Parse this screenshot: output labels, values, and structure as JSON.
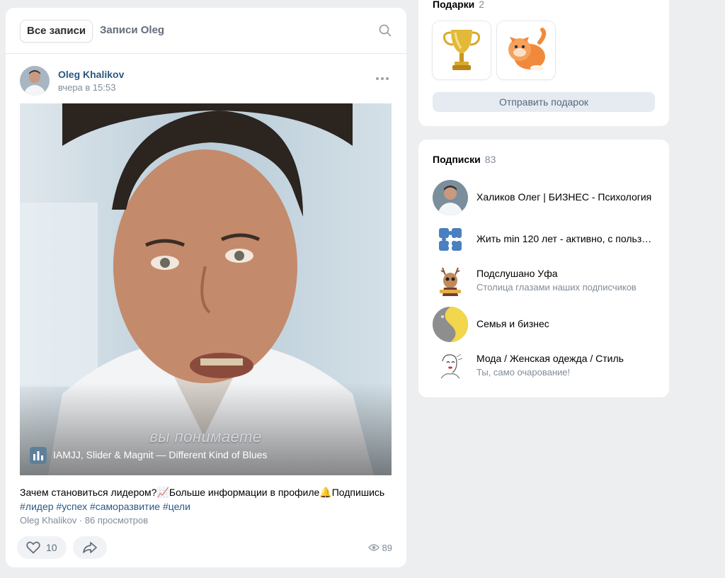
{
  "feed": {
    "tabs": [
      "Все записи",
      "Записи Oleg"
    ],
    "post": {
      "author": "Oleg Khalikov",
      "time": "вчера в 15:53",
      "video_subtitle": "вы понимаете",
      "music": "IAMJJ, Slider & Magnit — Different Kind of Blues",
      "caption": "Зачем становиться лидером?📈Больше информации в профиле🔔Подпишись",
      "tags": "#лидер #успех #саморазвитие #цели",
      "meta": "Oleg Khalikov · 86 просмотров",
      "likes": "10",
      "views": "89"
    }
  },
  "gifts": {
    "title": "Подарки",
    "count": "2",
    "items": [
      "trophy-gift",
      "cat-gift"
    ],
    "send_label": "Отправить подарок"
  },
  "subscriptions": {
    "title": "Подписки",
    "count": "83",
    "items": [
      {
        "name": "Халиков Олег | БИЗНЕС - Психология",
        "desc": ""
      },
      {
        "name": "Жить min 120 лет - активно, с польз…",
        "desc": ""
      },
      {
        "name": "Подслушано Уфа",
        "desc": "Столица глазами наших подписчиков"
      },
      {
        "name": "Семья и бизнес",
        "desc": ""
      },
      {
        "name": "Мода / Женская одежда / Стиль",
        "desc": "Ты, само очарование!"
      }
    ]
  },
  "colors": {
    "background": "#edeef0",
    "link": "#2a5885",
    "secondary_text": "#818c99",
    "button_bg": "#e5ebf1"
  }
}
